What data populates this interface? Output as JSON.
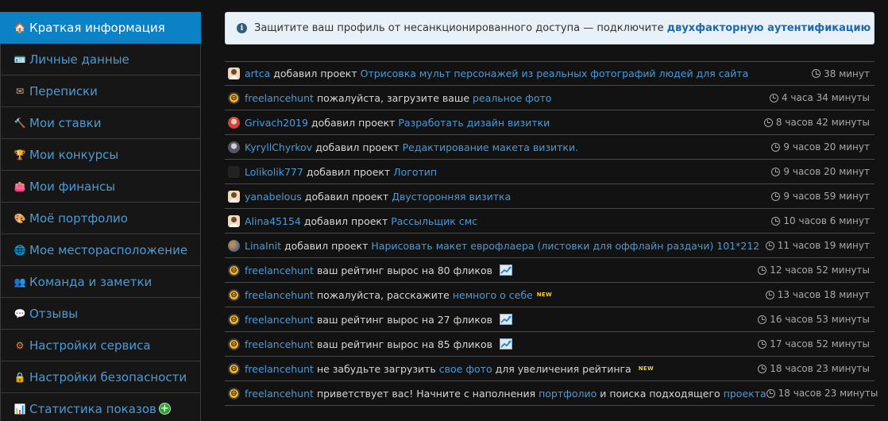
{
  "sidebar": {
    "items": [
      {
        "label": "Краткая информация",
        "icon": "home-icon",
        "active": true
      },
      {
        "label": "Личные данные",
        "icon": "id-card-icon"
      },
      {
        "label": "Переписки",
        "icon": "envelope-icon"
      },
      {
        "label": "Мои ставки",
        "icon": "gavel-icon"
      },
      {
        "label": "Мои конкурсы",
        "icon": "trophy-icon"
      },
      {
        "label": "Мои финансы",
        "icon": "wallet-icon"
      },
      {
        "label": "Моё портфолио",
        "icon": "palette-icon"
      },
      {
        "label": "Мое месторасположение",
        "icon": "globe-icon"
      },
      {
        "label": "Команда и заметки",
        "icon": "team-icon"
      },
      {
        "label": "Отзывы",
        "icon": "reviews-icon"
      },
      {
        "label": "Настройки сервиса",
        "icon": "service-settings-icon"
      },
      {
        "label": "Настройки безопасности",
        "icon": "lock-icon"
      },
      {
        "label": "Статистика показов",
        "icon": "stats-chart-icon",
        "badge": "+"
      }
    ]
  },
  "alert": {
    "text": "Защитите ваш профиль от несанкционированного доступа — подключите",
    "link": "двухфакторную аутентификацию",
    "icon": "info-icon"
  },
  "feed": [
    {
      "user": "artca",
      "avatar": "user",
      "action": "добавил проект",
      "link": "Отрисовка мульт персонажей из реальных фотографий людей для сайта",
      "time": "38 минут"
    },
    {
      "user": "freelancehunt",
      "avatar": "fh",
      "action": "пожалуйста, загрузите ваше",
      "link": "реальное фото",
      "time": "4 часа 34 минуты"
    },
    {
      "user": "Grivach2019",
      "avatar": "photo-a",
      "action": "добавил проект",
      "link": "Разработать дизайн визитки",
      "time": "8 часов 42 минуты"
    },
    {
      "user": "KyryllChyrkov",
      "avatar": "photo-b",
      "action": "добавил проект",
      "link": "Редактирование макета визитки.",
      "time": "9 часов 20 минут"
    },
    {
      "user": "Lolikolik777",
      "avatar": "photo-c",
      "action": "добавил проект",
      "link": "Логотип",
      "time": "9 часов 20 минут"
    },
    {
      "user": "yanabelous",
      "avatar": "user",
      "action": "добавил проект",
      "link": "Двусторонняя визитка",
      "time": "9 часов 59 минут"
    },
    {
      "user": "Alina45154",
      "avatar": "user",
      "action": "добавил проект",
      "link": "Рассыльщик смс",
      "time": "10 часов 6 минут"
    },
    {
      "user": "LinaInit",
      "avatar": "photo-d",
      "action": "добавил проект",
      "link": "Нарисовать макет еврофлаера (листовки для оффлайн раздачи) 101*212",
      "time": "11 часов 19 минут"
    },
    {
      "user": "freelancehunt",
      "avatar": "fh",
      "action": "ваш рейтинг вырос на 80 фликов",
      "link": "",
      "chart": true,
      "time": "12 часов 52 минуты"
    },
    {
      "user": "freelancehunt",
      "avatar": "fh",
      "action": "пожалуйста, расскажите",
      "link": "немного о себе",
      "new": "NEW",
      "time": "13 часов 18 минут"
    },
    {
      "user": "freelancehunt",
      "avatar": "fh",
      "action": "ваш рейтинг вырос на 27 фликов",
      "link": "",
      "chart": true,
      "time": "16 часов 53 минуты"
    },
    {
      "user": "freelancehunt",
      "avatar": "fh",
      "action": "ваш рейтинг вырос на 85 фликов",
      "link": "",
      "chart": true,
      "time": "17 часов 52 минуты"
    },
    {
      "user": "freelancehunt",
      "avatar": "fh",
      "action": "не забудьте загрузить",
      "link": "свое фото",
      "after": "для увеличения рейтинга",
      "new": "NEW",
      "time": "18 часов 23 минуты"
    },
    {
      "user": "freelancehunt",
      "avatar": "fh",
      "action": "приветствует вас! Начните с наполнения",
      "link": "портфолио",
      "after": "и поиска подходящего",
      "link2": "проекта",
      "time": "18 часов 23 минуты"
    }
  ],
  "colors": {
    "accent": "#0b82c6",
    "link": "#4b9ad6",
    "background": "#121212",
    "alert_bg": "#e8f1f8"
  }
}
